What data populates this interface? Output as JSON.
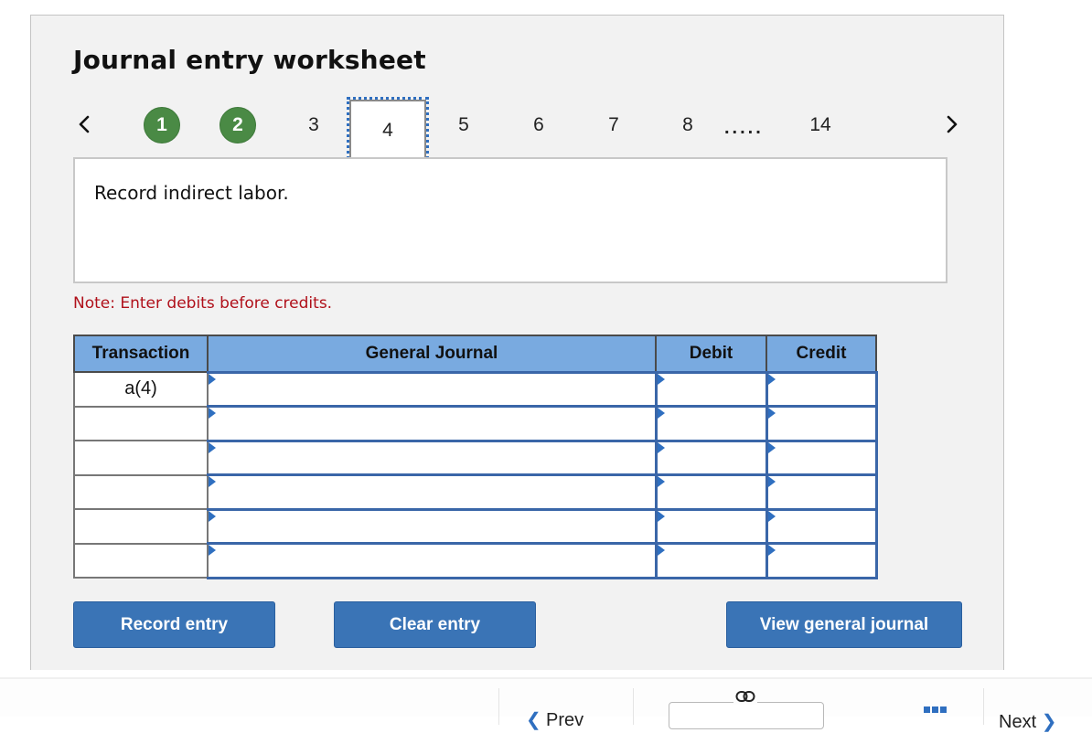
{
  "worksheet": {
    "title": "Journal entry worksheet",
    "steps": [
      {
        "label": "1",
        "status": "completed"
      },
      {
        "label": "2",
        "status": "completed"
      },
      {
        "label": "3",
        "status": "pending"
      },
      {
        "label": "4",
        "status": "current"
      },
      {
        "label": "5",
        "status": "pending"
      },
      {
        "label": "6",
        "status": "pending"
      },
      {
        "label": "7",
        "status": "pending"
      },
      {
        "label": "8",
        "status": "pending"
      },
      {
        "label": "14",
        "status": "pending"
      }
    ],
    "ellipsis": ".....",
    "prev_icon": "chevron-left-icon",
    "next_icon": "chevron-right-icon",
    "question": "Record indirect labor.",
    "note": "Note: Enter debits before credits.",
    "table": {
      "headers": [
        "Transaction",
        "General Journal",
        "Debit",
        "Credit"
      ],
      "rows": [
        {
          "transaction": "a(4)",
          "account": "",
          "debit": "",
          "credit": ""
        },
        {
          "transaction": "",
          "account": "",
          "debit": "",
          "credit": ""
        },
        {
          "transaction": "",
          "account": "",
          "debit": "",
          "credit": ""
        },
        {
          "transaction": "",
          "account": "",
          "debit": "",
          "credit": ""
        },
        {
          "transaction": "",
          "account": "",
          "debit": "",
          "credit": ""
        },
        {
          "transaction": "",
          "account": "",
          "debit": "",
          "credit": ""
        }
      ]
    },
    "buttons": {
      "record": "Record entry",
      "clear": "Clear entry",
      "view": "View general journal"
    }
  },
  "bottom_nav": {
    "prev_label": "Prev",
    "next_label": "Next",
    "link_icon": "link-icon",
    "grid_icon": "grid-icon"
  },
  "colors": {
    "completed_step": "#4a8a45",
    "header_blue": "#79aae0",
    "button_blue": "#3a74b6",
    "note_red": "#b0101a"
  }
}
